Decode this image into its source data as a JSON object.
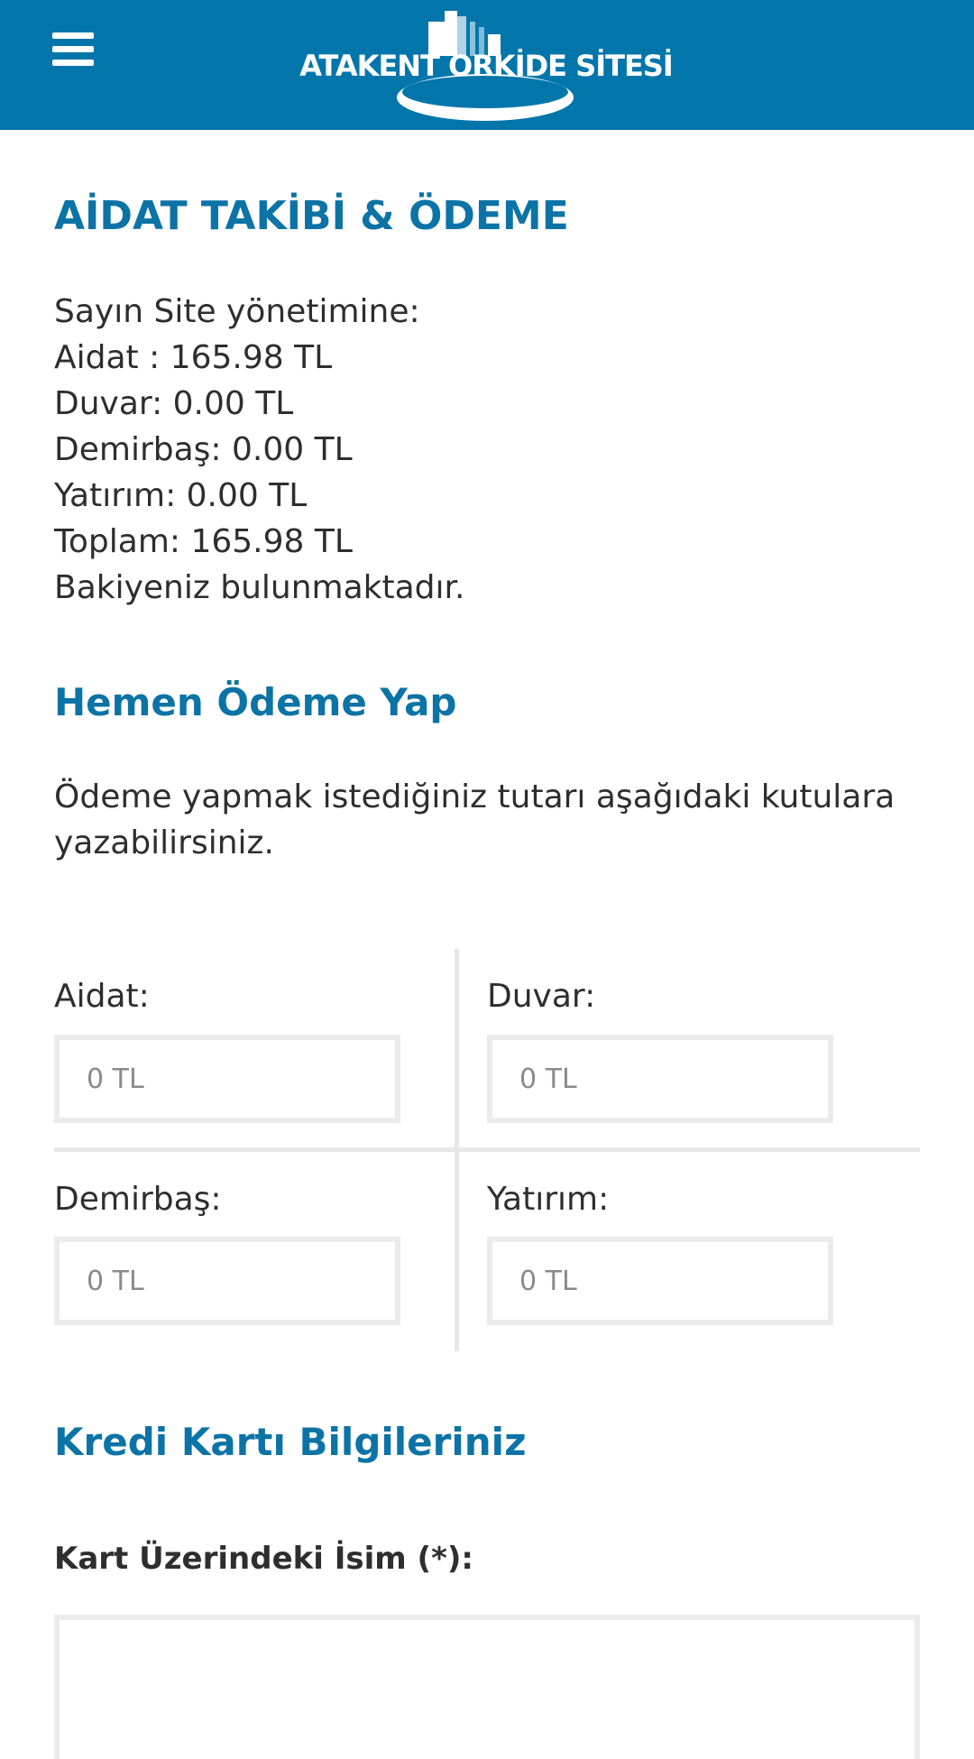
{
  "header": {
    "menu_icon": "hamburger-menu-icon",
    "logo_text": "ATAKENT ORKİDE SİTESİ",
    "logo_subtext": "ORKİDE SİTESİ",
    "background_color": "#0276ab"
  },
  "main": {
    "title": "AİDAT TAKİBİ & ÖDEME",
    "info_lines": [
      "Sayın    Site yönetimine:",
      "Aidat : 165.98 TL",
      "Duvar: 0.00 TL",
      "Demirbaş: 0.00 TL",
      "Yatırım: 0.00 TL",
      "Toplam: 165.98 TL",
      "Bakiyeniz bulunmaktadır."
    ]
  },
  "payment": {
    "title": "Hemen Ödeme Yap",
    "intro": "Ödeme yapmak istediğiniz tutarı aşağıdaki kutulara yazabilirsiniz.",
    "fields": [
      {
        "label": "Aidat:",
        "placeholder": "0 TL"
      },
      {
        "label": "Duvar:",
        "placeholder": "0 TL"
      },
      {
        "label": "Demirbaş:",
        "placeholder": "0 TL"
      },
      {
        "label": "Yatırım:",
        "placeholder": "0 TL"
      }
    ]
  },
  "card": {
    "title": "Kredi Kartı Bilgileriniz",
    "name_label": "Kart Üzerindeki İsim (*):",
    "name_value": ""
  },
  "colors": {
    "accent": "#0c73a6",
    "border": "#ebebeb"
  }
}
